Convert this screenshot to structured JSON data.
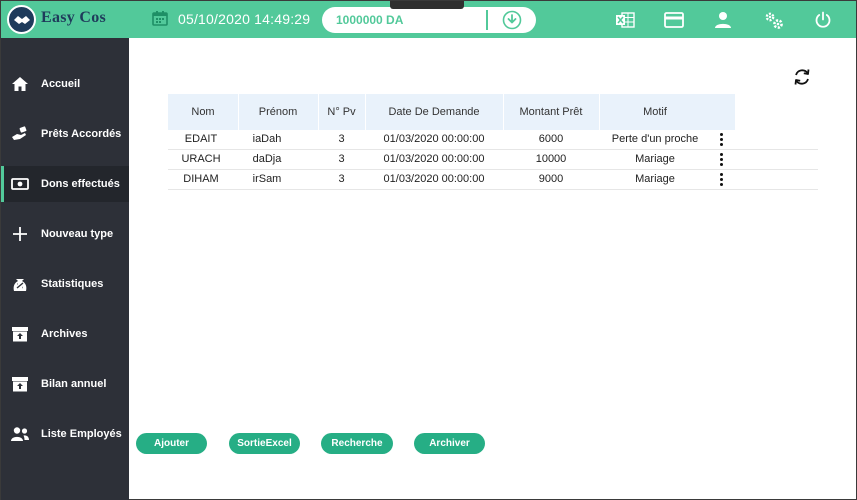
{
  "app": {
    "name": "Easy Cos"
  },
  "header": {
    "datetime": "05/10/2020 14:49:29",
    "balance": "1000000 DA",
    "icons": [
      "download-icon",
      "excel-icon",
      "card-icon",
      "user-icon",
      "settings-icon",
      "power-icon"
    ]
  },
  "colors": {
    "accent": "#52c99a",
    "sidebar": "#2d3038",
    "button": "#26ae85",
    "header_row": "#e9f2fb"
  },
  "sidebar": {
    "items": [
      {
        "label": "Accueil",
        "icon": "home-icon"
      },
      {
        "label": "Prêts Accordés",
        "icon": "loan-icon"
      },
      {
        "label": "Dons effectués",
        "icon": "cash-icon",
        "active": true
      },
      {
        "label": "Nouveau type",
        "icon": "plus-icon"
      },
      {
        "label": "Statistiques",
        "icon": "stats-icon"
      },
      {
        "label": "Archives",
        "icon": "archive-icon"
      },
      {
        "label": "Bilan annuel",
        "icon": "archive-up-icon"
      },
      {
        "label": "Liste Employés",
        "icon": "people-icon"
      }
    ]
  },
  "table": {
    "columns": [
      "Nom",
      "Prénom",
      "N° Pv",
      "Date De Demande",
      "Montant Prêt",
      "Motif"
    ],
    "rows": [
      [
        "EDAIT",
        "iaDah",
        "3",
        "01/03/2020 00:00:00",
        "6000",
        "Perte d'un proche"
      ],
      [
        "URACH",
        "daDja",
        "3",
        "01/03/2020 00:00:00",
        "10000",
        "Mariage"
      ],
      [
        "DIHAM",
        "irSam",
        "3",
        "01/03/2020 00:00:00",
        "9000",
        "Mariage"
      ]
    ]
  },
  "buttons": {
    "add": "Ajouter",
    "export": "SortieExcel",
    "search": "Recherche",
    "archive": "Archiver"
  }
}
